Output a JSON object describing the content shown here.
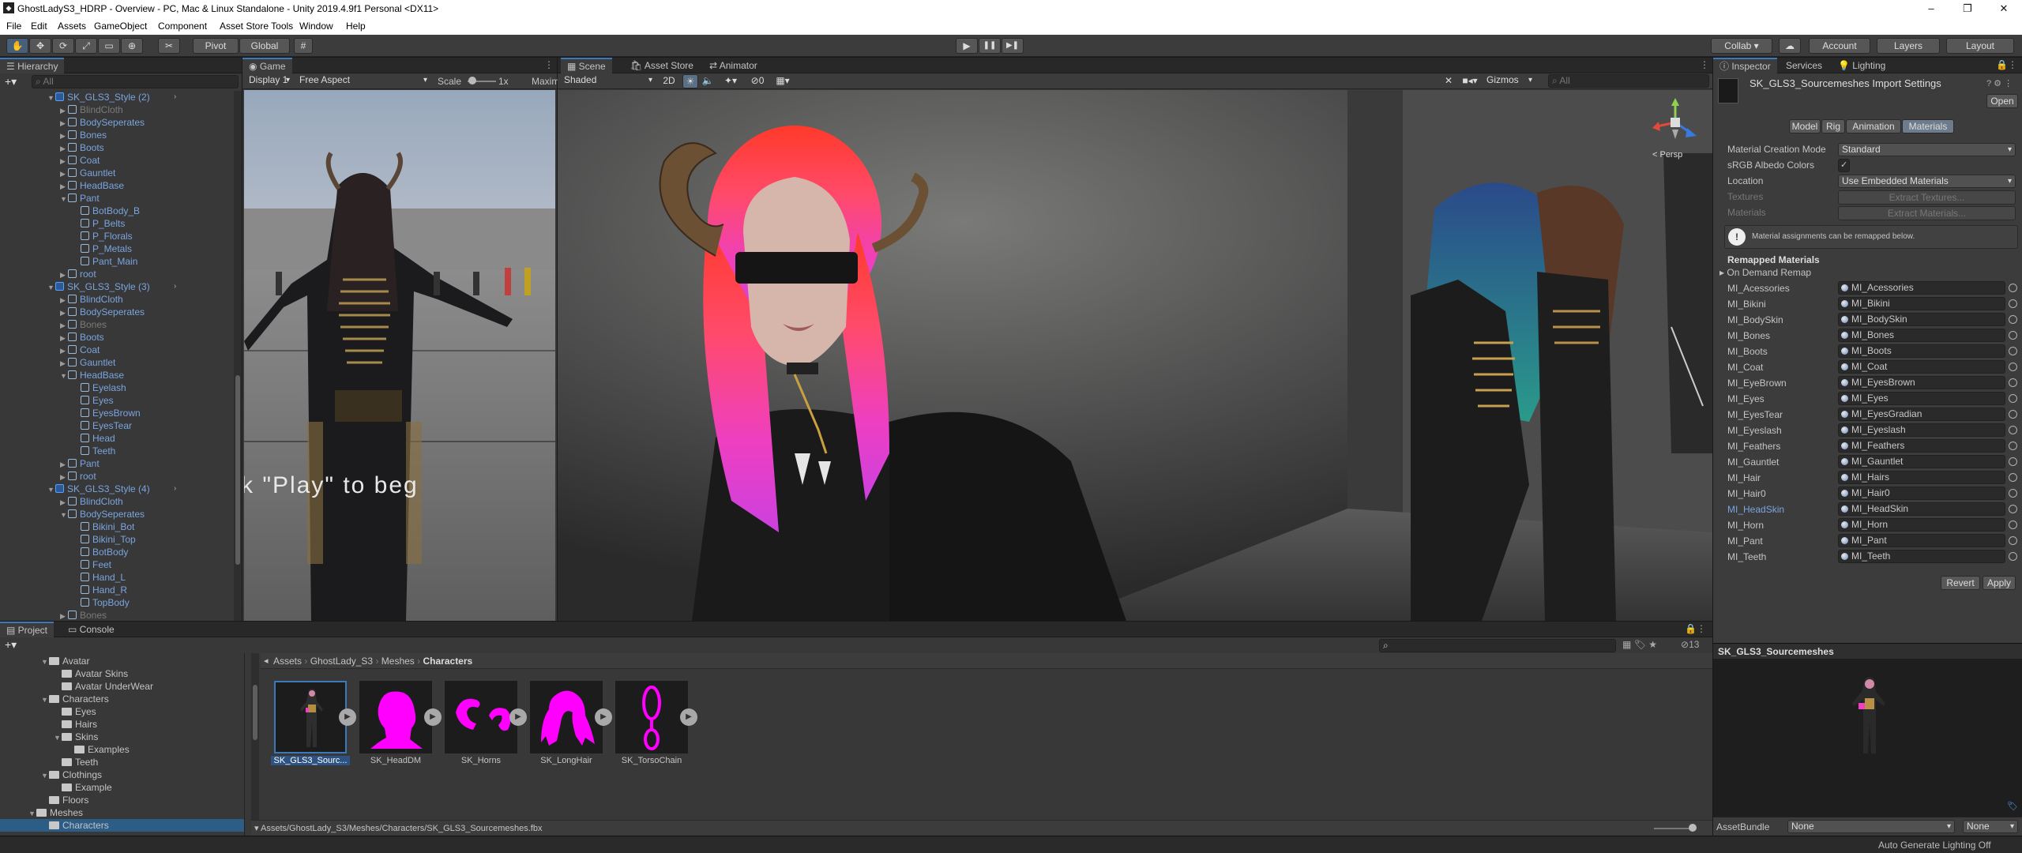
{
  "window": {
    "title": "GhostLadyS3_HDRP - Overview - PC, Mac & Linux Standalone - Unity 2019.4.9f1 Personal <DX11>",
    "min": "–",
    "max": "❐",
    "close": "✕"
  },
  "menu": [
    "File",
    "Edit",
    "Assets",
    "GameObject",
    "Component",
    "Asset Store Tools",
    "Window",
    "Help"
  ],
  "toolbar": {
    "pivot": "Pivot",
    "global": "Global",
    "play": "▶",
    "pause": "❚❚",
    "step": "▶❚",
    "collab": "Collab ▾",
    "account": "Account",
    "layers": "Layers",
    "layout": "Layout"
  },
  "hierarchy": {
    "tab": "Hierarchy",
    "search_placeholder": "All",
    "rows": [
      {
        "text": "SK_GLS3_Style (2)",
        "indent": 0,
        "kind": "prefab",
        "color": "blue",
        "fold": "▼"
      },
      {
        "text": "BlindCloth",
        "indent": 1,
        "kind": "cube",
        "color": "gray",
        "fold": "▶"
      },
      {
        "text": "BodySeperates",
        "indent": 1,
        "kind": "cube",
        "color": "blue",
        "fold": "▶"
      },
      {
        "text": "Bones",
        "indent": 1,
        "kind": "cube",
        "color": "blue",
        "fold": "▶"
      },
      {
        "text": "Boots",
        "indent": 1,
        "kind": "cube",
        "color": "blue",
        "fold": "▶"
      },
      {
        "text": "Coat",
        "indent": 1,
        "kind": "cube",
        "color": "blue",
        "fold": "▶"
      },
      {
        "text": "Gauntlet",
        "indent": 1,
        "kind": "cube",
        "color": "blue",
        "fold": "▶"
      },
      {
        "text": "HeadBase",
        "indent": 1,
        "kind": "cube",
        "color": "blue",
        "fold": "▶"
      },
      {
        "text": "Pant",
        "indent": 1,
        "kind": "cube",
        "color": "blue",
        "fold": "▼"
      },
      {
        "text": "BotBody_B",
        "indent": 2,
        "kind": "cube",
        "color": "blue",
        "fold": ""
      },
      {
        "text": "P_Belts",
        "indent": 2,
        "kind": "cube",
        "color": "blue",
        "fold": ""
      },
      {
        "text": "P_Florals",
        "indent": 2,
        "kind": "cube",
        "color": "blue",
        "fold": ""
      },
      {
        "text": "P_Metals",
        "indent": 2,
        "kind": "cube",
        "color": "blue",
        "fold": ""
      },
      {
        "text": "Pant_Main",
        "indent": 2,
        "kind": "cube",
        "color": "blue",
        "fold": ""
      },
      {
        "text": "root",
        "indent": 1,
        "kind": "cube",
        "color": "blue",
        "fold": "▶"
      },
      {
        "text": "SK_GLS3_Style (3)",
        "indent": 0,
        "kind": "prefab",
        "color": "blue",
        "fold": "▼"
      },
      {
        "text": "BlindCloth",
        "indent": 1,
        "kind": "cube",
        "color": "blue",
        "fold": "▶"
      },
      {
        "text": "BodySeperates",
        "indent": 1,
        "kind": "cube",
        "color": "blue",
        "fold": "▶"
      },
      {
        "text": "Bones",
        "indent": 1,
        "kind": "cube",
        "color": "gray",
        "fold": "▶"
      },
      {
        "text": "Boots",
        "indent": 1,
        "kind": "cube",
        "color": "blue",
        "fold": "▶"
      },
      {
        "text": "Coat",
        "indent": 1,
        "kind": "cube",
        "color": "blue",
        "fold": "▶"
      },
      {
        "text": "Gauntlet",
        "indent": 1,
        "kind": "cube",
        "color": "blue",
        "fold": "▶"
      },
      {
        "text": "HeadBase",
        "indent": 1,
        "kind": "cube",
        "color": "blue",
        "fold": "▼"
      },
      {
        "text": "Eyelash",
        "indent": 2,
        "kind": "cube",
        "color": "blue",
        "fold": ""
      },
      {
        "text": "Eyes",
        "indent": 2,
        "kind": "cube",
        "color": "blue",
        "fold": ""
      },
      {
        "text": "EyesBrown",
        "indent": 2,
        "kind": "cube",
        "color": "blue",
        "fold": ""
      },
      {
        "text": "EyesTear",
        "indent": 2,
        "kind": "cube",
        "color": "blue",
        "fold": ""
      },
      {
        "text": "Head",
        "indent": 2,
        "kind": "cube",
        "color": "blue",
        "fold": ""
      },
      {
        "text": "Teeth",
        "indent": 2,
        "kind": "cube",
        "color": "blue",
        "fold": ""
      },
      {
        "text": "Pant",
        "indent": 1,
        "kind": "cube",
        "color": "blue",
        "fold": "▶"
      },
      {
        "text": "root",
        "indent": 1,
        "kind": "cube",
        "color": "blue",
        "fold": "▶"
      },
      {
        "text": "SK_GLS3_Style (4)",
        "indent": 0,
        "kind": "prefab",
        "color": "blue",
        "fold": "▼"
      },
      {
        "text": "BlindCloth",
        "indent": 1,
        "kind": "cube",
        "color": "blue",
        "fold": "▶"
      },
      {
        "text": "BodySeperates",
        "indent": 1,
        "kind": "cube",
        "color": "blue",
        "fold": "▼"
      },
      {
        "text": "Bikini_Bot",
        "indent": 2,
        "kind": "cube",
        "color": "blue",
        "fold": ""
      },
      {
        "text": "Bikini_Top",
        "indent": 2,
        "kind": "cube",
        "color": "blue",
        "fold": ""
      },
      {
        "text": "BotBody",
        "indent": 2,
        "kind": "cube",
        "color": "blue",
        "fold": ""
      },
      {
        "text": "Feet",
        "indent": 2,
        "kind": "cube",
        "color": "blue",
        "fold": ""
      },
      {
        "text": "Hand_L",
        "indent": 2,
        "kind": "cube",
        "color": "blue",
        "fold": ""
      },
      {
        "text": "Hand_R",
        "indent": 2,
        "kind": "cube",
        "color": "blue",
        "fold": ""
      },
      {
        "text": "TopBody",
        "indent": 2,
        "kind": "cube",
        "color": "blue",
        "fold": ""
      },
      {
        "text": "Bones",
        "indent": 1,
        "kind": "cube",
        "color": "gray",
        "fold": "▶"
      }
    ]
  },
  "game": {
    "tab": "Game",
    "display": "Display 1",
    "aspect": "Free Aspect",
    "scale_label": "Scale",
    "scale_value": "1x",
    "maximize": "Maxim",
    "overlay_text": "k \"Play\" to beg"
  },
  "scene": {
    "tabs": [
      "Scene",
      "Asset Store",
      "Animator"
    ],
    "shading": "Shaded",
    "mode_2d": "2D",
    "gizmos": "Gizmos",
    "search_placeholder": "All",
    "persp": "< Persp",
    "hidden_count": "0"
  },
  "inspector": {
    "tabs": [
      "Inspector",
      "Services",
      "Lighting"
    ],
    "title": "SK_GLS3_Sourcemeshes Import Settings",
    "open": "Open",
    "subtabs": [
      "Model",
      "Rig",
      "Animation",
      "Materials"
    ],
    "fields": [
      {
        "label": "Material Creation Mode",
        "value": "Standard"
      },
      {
        "label": "sRGB Albedo Colors",
        "value": "✓"
      },
      {
        "label": "Location",
        "value": "Use Embedded Materials"
      },
      {
        "label": "Textures",
        "value": "Extract Textures..."
      },
      {
        "label": "Materials",
        "value": "Extract Materials..."
      }
    ],
    "info": "Material assignments can be remapped below.",
    "remapped_header": "Remapped Materials",
    "on_demand": "On Demand Remap",
    "materials": [
      {
        "name": "MI_Acessories",
        "value": "MI_Acessories"
      },
      {
        "name": "MI_Bikini",
        "value": "MI_Bikini"
      },
      {
        "name": "MI_BodySkin",
        "value": "MI_BodySkin"
      },
      {
        "name": "MI_Bones",
        "value": "MI_Bones"
      },
      {
        "name": "MI_Boots",
        "value": "MI_Boots"
      },
      {
        "name": "MI_Coat",
        "value": "MI_Coat"
      },
      {
        "name": "MI_EyeBrown",
        "value": "MI_EyesBrown"
      },
      {
        "name": "MI_Eyes",
        "value": "MI_Eyes"
      },
      {
        "name": "MI_EyesTear",
        "value": "MI_EyesGradian"
      },
      {
        "name": "MI_Eyeslash",
        "value": "MI_Eyeslash"
      },
      {
        "name": "MI_Feathers",
        "value": "MI_Feathers"
      },
      {
        "name": "MI_Gauntlet",
        "value": "MI_Gauntlet"
      },
      {
        "name": "MI_Hair",
        "value": "MI_Hairs"
      },
      {
        "name": "MI_Hair0",
        "value": "MI_Hair0"
      },
      {
        "name": "MI_HeadSkin",
        "value": "MI_HeadSkin"
      },
      {
        "name": "MI_Horn",
        "value": "MI_Horn"
      },
      {
        "name": "MI_Pant",
        "value": "MI_Pant"
      },
      {
        "name": "MI_Teeth",
        "value": "MI_Teeth"
      }
    ],
    "revert": "Revert",
    "apply": "Apply",
    "preview_title": "SK_GLS3_Sourcemeshes",
    "assetbundle_label": "AssetBundle",
    "assetbundle_value": "None",
    "assetbundle_variant": "None"
  },
  "project": {
    "tabs": [
      "Project",
      "Console"
    ],
    "tree": [
      {
        "text": "Avatar",
        "indent": 1,
        "fold": "▼"
      },
      {
        "text": "Avatar Skins",
        "indent": 2,
        "fold": ""
      },
      {
        "text": "Avatar UnderWear",
        "indent": 2,
        "fold": ""
      },
      {
        "text": "Characters",
        "indent": 1,
        "fold": "▼"
      },
      {
        "text": "Eyes",
        "indent": 2,
        "fold": ""
      },
      {
        "text": "Hairs",
        "indent": 2,
        "fold": ""
      },
      {
        "text": "Skins",
        "indent": 2,
        "fold": "▼"
      },
      {
        "text": "Examples",
        "indent": 3,
        "fold": ""
      },
      {
        "text": "Teeth",
        "indent": 2,
        "fold": ""
      },
      {
        "text": "Clothings",
        "indent": 1,
        "fold": "▼"
      },
      {
        "text": "Example",
        "indent": 2,
        "fold": ""
      },
      {
        "text": "Floors",
        "indent": 1,
        "fold": ""
      },
      {
        "text": "Meshes",
        "indent": 0,
        "fold": "▼"
      },
      {
        "text": "Characters",
        "indent": 1,
        "fold": ""
      }
    ],
    "breadcrumb": [
      "Assets",
      "GhostLady_S3",
      "Meshes",
      "Characters"
    ],
    "assets": [
      {
        "name": "SK_GLS3_Sourc...",
        "kind": "body"
      },
      {
        "name": "SK_HeadDM",
        "kind": "head"
      },
      {
        "name": "SK_Horns",
        "kind": "horns"
      },
      {
        "name": "SK_LongHair",
        "kind": "hair"
      },
      {
        "name": "SK_TorsoChain",
        "kind": "chain"
      }
    ],
    "path": "Assets/GhostLady_S3/Meshes/Characters/SK_GLS3_Sourcemeshes.fbx",
    "count": "13"
  },
  "statusbar": {
    "text": "Auto Generate Lighting Off"
  },
  "colors": {
    "accent": "#3a79bb",
    "hair": "#ff2aa8",
    "magenta": "#ff00ff"
  }
}
